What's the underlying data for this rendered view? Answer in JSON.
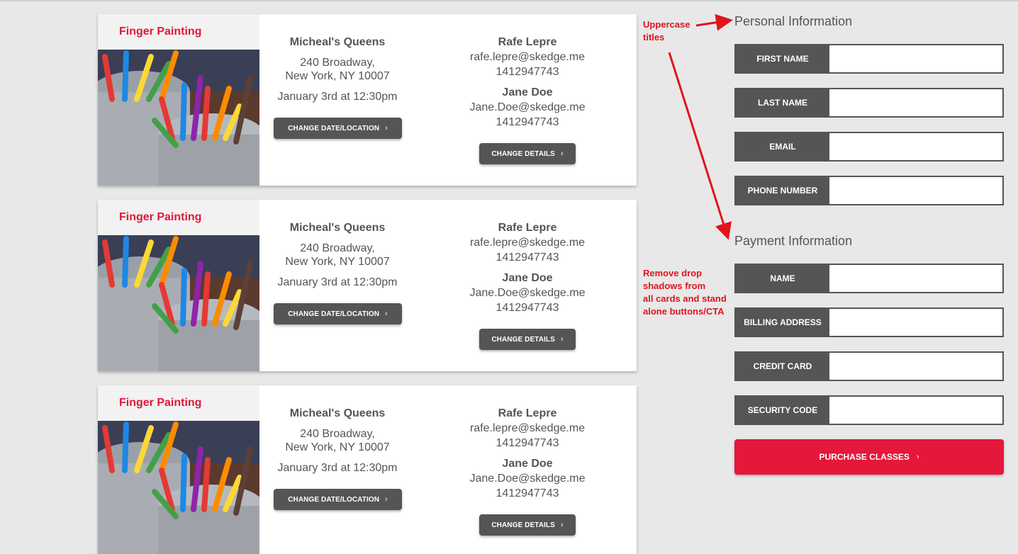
{
  "cards": [
    {
      "title": "Finger Painting",
      "location_name": "Micheal's Queens",
      "address_line1": "240 Broadway,",
      "address_line2": "New York, NY 10007",
      "date": "January 3rd at 12:30pm",
      "change_location_label": "CHANGE DATE/LOCATION",
      "contact1_name": "Rafe Lepre",
      "contact1_email": "rafe.lepre@skedge.me",
      "contact1_phone": "1412947743",
      "contact2_name": "Jane Doe",
      "contact2_email": "Jane.Doe@skedge.me",
      "contact2_phone": "1412947743",
      "change_details_label": "CHANGE DETAILS"
    },
    {
      "title": "Finger Painting",
      "location_name": "Micheal's Queens",
      "address_line1": "240 Broadway,",
      "address_line2": "New York, NY 10007",
      "date": "January 3rd at 12:30pm",
      "change_location_label": "CHANGE DATE/LOCATION",
      "contact1_name": "Rafe Lepre",
      "contact1_email": "rafe.lepre@skedge.me",
      "contact1_phone": "1412947743",
      "contact2_name": "Jane Doe",
      "contact2_email": "Jane.Doe@skedge.me",
      "contact2_phone": "1412947743",
      "change_details_label": "CHANGE DETAILS"
    },
    {
      "title": "Finger Painting",
      "location_name": "Micheal's Queens",
      "address_line1": "240 Broadway,",
      "address_line2": "New York, NY 10007",
      "date": "January 3rd at 12:30pm",
      "change_location_label": "CHANGE DATE/LOCATION",
      "contact1_name": "Rafe Lepre",
      "contact1_email": "rafe.lepre@skedge.me",
      "contact1_phone": "1412947743",
      "contact2_name": "Jane Doe",
      "contact2_email": "Jane.Doe@skedge.me",
      "contact2_phone": "1412947743",
      "change_details_label": "CHANGE DETAILS"
    }
  ],
  "personal": {
    "title": "Personal Information",
    "fields": [
      {
        "label": "FIRST NAME",
        "value": ""
      },
      {
        "label": "LAST NAME",
        "value": ""
      },
      {
        "label": "EMAIL",
        "value": ""
      },
      {
        "label": "PHONE NUMBER",
        "value": ""
      }
    ]
  },
  "payment": {
    "title": "Payment Information",
    "fields": [
      {
        "label": "NAME",
        "value": ""
      },
      {
        "label": "BILLING ADDRESS",
        "value": ""
      },
      {
        "label": "CREDIT CARD",
        "value": ""
      },
      {
        "label": "SECURITY CODE",
        "value": ""
      }
    ]
  },
  "cta": {
    "label": "PURCHASE CLASSES"
  },
  "annotations": {
    "uppercase_line1": "Uppercase",
    "uppercase_line2": "titles",
    "shadow_line1": "Remove drop",
    "shadow_line2": "shadows from",
    "shadow_line3": "all cards and stand",
    "shadow_line4": "alone buttons/CTA"
  },
  "colors": {
    "accent": "#e5173a",
    "dark": "#555555",
    "background": "#e8e8e8",
    "annotation": "#e0141e"
  },
  "icons": {
    "chevron": "chevron-right-icon",
    "card_image": "marker-cups-image"
  }
}
